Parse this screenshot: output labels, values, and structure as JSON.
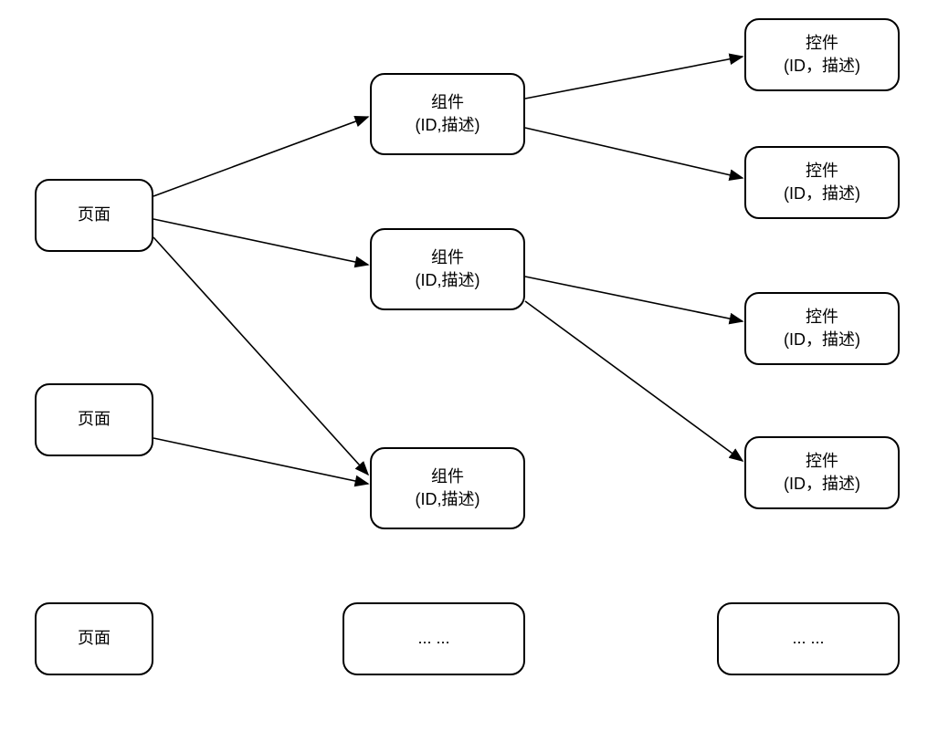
{
  "nodes": {
    "page1": {
      "label": "页面"
    },
    "page2": {
      "label": "页面"
    },
    "page3": {
      "label": "页面"
    },
    "comp1": {
      "line1": "组件",
      "line2": "(ID,描述)"
    },
    "comp2": {
      "line1": "组件",
      "line2": "(ID,描述)"
    },
    "comp3": {
      "line1": "组件",
      "line2": "(ID,描述)"
    },
    "comp4": {
      "label": "... ..."
    },
    "ctrl1": {
      "line1": "控件",
      "line2": "(ID，描述)"
    },
    "ctrl2": {
      "line1": "控件",
      "line2": "(ID，描述)"
    },
    "ctrl3": {
      "line1": "控件",
      "line2": "(ID，描述)"
    },
    "ctrl4": {
      "line1": "控件",
      "line2": "(ID，描述)"
    },
    "ctrl5": {
      "label": "... ..."
    }
  }
}
